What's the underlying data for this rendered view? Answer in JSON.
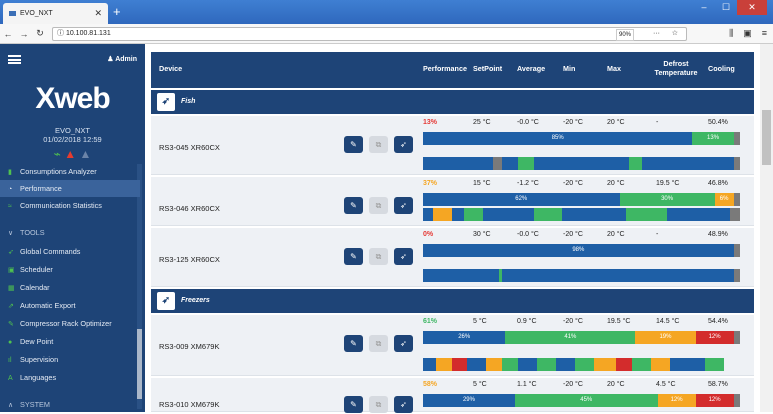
{
  "browser": {
    "tab_title": "EVO_NXT",
    "url": "10.100.81.131",
    "zoom": "90%"
  },
  "sidebar": {
    "user": "Admin",
    "logo": "Xweb",
    "device_name": "EVO_NXT",
    "datetime": "01/02/2018 12:59",
    "items": [
      {
        "label": "Consumptions Analyzer"
      },
      {
        "label": "Performance"
      },
      {
        "label": "Communication Statistics"
      },
      {
        "label": "TOOLS"
      },
      {
        "label": "Global Commands"
      },
      {
        "label": "Scheduler"
      },
      {
        "label": "Calendar"
      },
      {
        "label": "Automatic Export"
      },
      {
        "label": "Compressor Rack Optimizer"
      },
      {
        "label": "Dew Point"
      },
      {
        "label": "Supervision"
      },
      {
        "label": "Languages"
      },
      {
        "label": "SYSTEM"
      }
    ]
  },
  "table": {
    "headers": {
      "device": "Device",
      "performance": "Performance",
      "setpoint": "SetPoint",
      "average": "Average",
      "min": "Min",
      "max": "Max",
      "defrost": "Defrost Temperature",
      "cooling": "Cooling"
    },
    "groups": [
      {
        "label": "Fish"
      },
      {
        "label": "Freezers"
      }
    ],
    "devices": [
      {
        "name": "RS3-045 XR60CX",
        "performance": "13%",
        "perf_color": "#e53935",
        "setpoint": "25 °C",
        "average": "-0.0 °C",
        "min": "-20 °C",
        "max": "20 °C",
        "defrost": "-",
        "cooling": "50.4%",
        "bar": [
          {
            "pct": 85,
            "label": "85%",
            "c": "blue"
          },
          {
            "pct": 13,
            "label": "13%",
            "c": "green"
          },
          {
            "pct": 2,
            "label": "",
            "c": "gray"
          }
        ]
      },
      {
        "name": "RS3-046 XR60CX",
        "performance": "37%",
        "perf_color": "#f5a623",
        "setpoint": "15 °C",
        "average": "-1.2 °C",
        "min": "-20 °C",
        "max": "20 °C",
        "defrost": "19.5 °C",
        "cooling": "46.8%",
        "bar": [
          {
            "pct": 62,
            "label": "62%",
            "c": "blue"
          },
          {
            "pct": 30,
            "label": "30%",
            "c": "green"
          },
          {
            "pct": 6,
            "label": "6%",
            "c": "orange"
          },
          {
            "pct": 2,
            "label": "",
            "c": "gray"
          }
        ]
      },
      {
        "name": "RS3-125 XR60CX",
        "performance": "0%",
        "perf_color": "#e53935",
        "setpoint": "30 °C",
        "average": "-0.0 °C",
        "min": "-20 °C",
        "max": "20 °C",
        "defrost": "-",
        "cooling": "48.9%",
        "bar": [
          {
            "pct": 98,
            "label": "98%",
            "c": "blue"
          },
          {
            "pct": 2,
            "label": "",
            "c": "gray"
          }
        ]
      },
      {
        "name": "RS3-009 XM679K",
        "performance": "61%",
        "perf_color": "#3eb764",
        "setpoint": "5 °C",
        "average": "0.9 °C",
        "min": "-20 °C",
        "max": "19.5 °C",
        "defrost": "14.5 °C",
        "cooling": "54.4%",
        "bar": [
          {
            "pct": 26,
            "label": "26%",
            "c": "blue"
          },
          {
            "pct": 41,
            "label": "41%",
            "c": "green"
          },
          {
            "pct": 19,
            "label": "19%",
            "c": "orange"
          },
          {
            "pct": 12,
            "label": "12%",
            "c": "red"
          },
          {
            "pct": 2,
            "label": "",
            "c": "gray"
          }
        ]
      },
      {
        "name": "RS3-010 XM679K",
        "performance": "58%",
        "perf_color": "#f5a623",
        "setpoint": "5 °C",
        "average": "1.1 °C",
        "min": "-20 °C",
        "max": "20 °C",
        "defrost": "4.5 °C",
        "cooling": "58.7%",
        "bar": [
          {
            "pct": 29,
            "label": "29%",
            "c": "blue"
          },
          {
            "pct": 45,
            "label": "45%",
            "c": "green"
          },
          {
            "pct": 12,
            "label": "12%",
            "c": "orange"
          },
          {
            "pct": 12,
            "label": "12%",
            "c": "red"
          },
          {
            "pct": 2,
            "label": "",
            "c": "gray"
          }
        ]
      }
    ]
  }
}
